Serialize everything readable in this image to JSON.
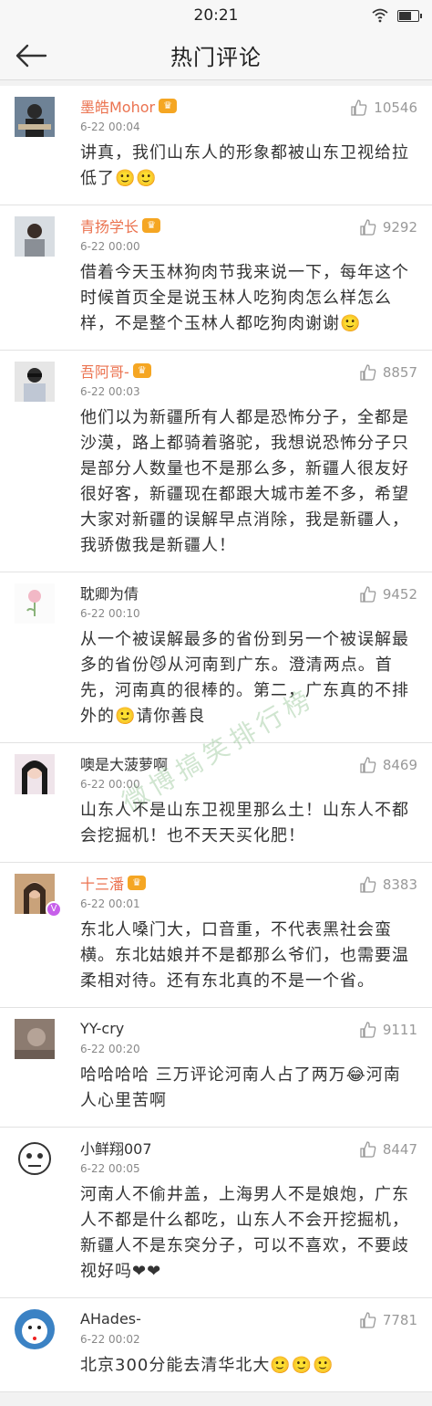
{
  "status": {
    "time": "20:21",
    "battery_level": 0.7
  },
  "nav": {
    "title": "热门评论"
  },
  "comments": [
    {
      "name": "墨皓Mohor",
      "likes": "10546",
      "time": "6-22 00:04",
      "text": "讲真，我们山东人的形象都被山东卫视给拉低了🙂🙂"
    },
    {
      "name": "青扬学长",
      "likes": "9292",
      "time": "6-22 00:00",
      "text": "借着今天玉林狗肉节我来说一下，每年这个时候首页全是说玉林人吃狗肉怎么样怎么样，不是整个玉林人都吃狗肉谢谢🙂"
    },
    {
      "name": "吾阿哥-",
      "likes": "8857",
      "time": "6-22 00:03",
      "text": "他们以为新疆所有人都是恐怖分子，全都是沙漠，路上都骑着骆驼，我想说恐怖分子只是部分人数量也不是那么多，新疆人很友好很好客，新疆现在都跟大城市差不多，希望大家对新疆的误解早点消除，我是新疆人，我骄傲我是新疆人！"
    },
    {
      "name": "耽卿为倩",
      "likes": "9452",
      "time": "6-22 00:10",
      "text": "从一个被误解最多的省份到另一个被误解最多的省份😼从河南到广东。澄清两点。首先，河南真的很棒的。第二，广东真的不排外的🙂请你善良"
    },
    {
      "name": "噢是大菠萝啊",
      "likes": "8469",
      "time": "6-22 00:00",
      "text": "山东人不是山东卫视里那么土！山东人不都会挖掘机！也不天天买化肥！"
    },
    {
      "name": "十三潘",
      "likes": "8383",
      "time": "6-22 00:01",
      "text": "东北人嗓门大，口音重，不代表黑社会蛮横。东北姑娘并不是都那么爷们，也需要温柔相对待。还有东北真的不是一个省。"
    },
    {
      "name": "YY-cry",
      "likes": "9111",
      "time": "6-22 00:20",
      "text": "哈哈哈哈 三万评论河南人占了两万😂河南人心里苦啊"
    },
    {
      "name": "小鲜翔007",
      "likes": "8447",
      "time": "6-22 00:05",
      "text": "河南人不偷井盖，上海男人不是娘炮，广东人不都是什么都吃，山东人不会开挖掘机，新疆人不是东突分子，可以不喜欢，不要歧视好吗❤❤"
    },
    {
      "name": "AHades-",
      "likes": "7781",
      "time": "6-22 00:02",
      "text": "北京300分能去清华北大🙂🙂🙂"
    }
  ],
  "watermark": "微博搞笑排行榜",
  "colors": {
    "gold_name": "#eb7350",
    "vip_badge": "#c760ea"
  }
}
